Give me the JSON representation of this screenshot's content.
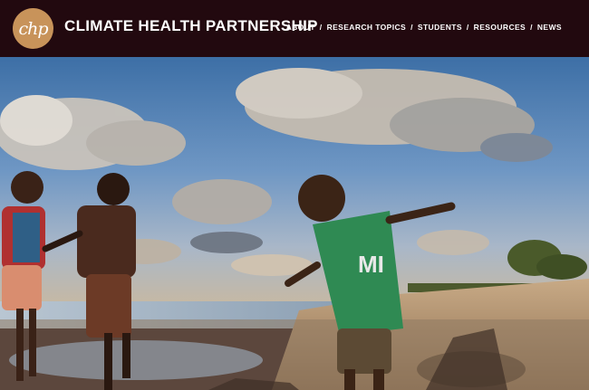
{
  "header": {
    "logo_text": "chp",
    "title": "CLIMATE HEALTH PARTNERSHIP",
    "nav": [
      {
        "label": "ABOUT"
      },
      {
        "label": "RESEARCH TOPICS"
      },
      {
        "label": "STUDENTS"
      },
      {
        "label": "RESOURCES"
      },
      {
        "label": "NEWS"
      }
    ],
    "separator": "/"
  },
  "hero": {
    "shirt_text": "MI"
  },
  "colors": {
    "header_bg": "#22090f",
    "logo_bg": "#c8935a",
    "text": "#ffffff"
  }
}
